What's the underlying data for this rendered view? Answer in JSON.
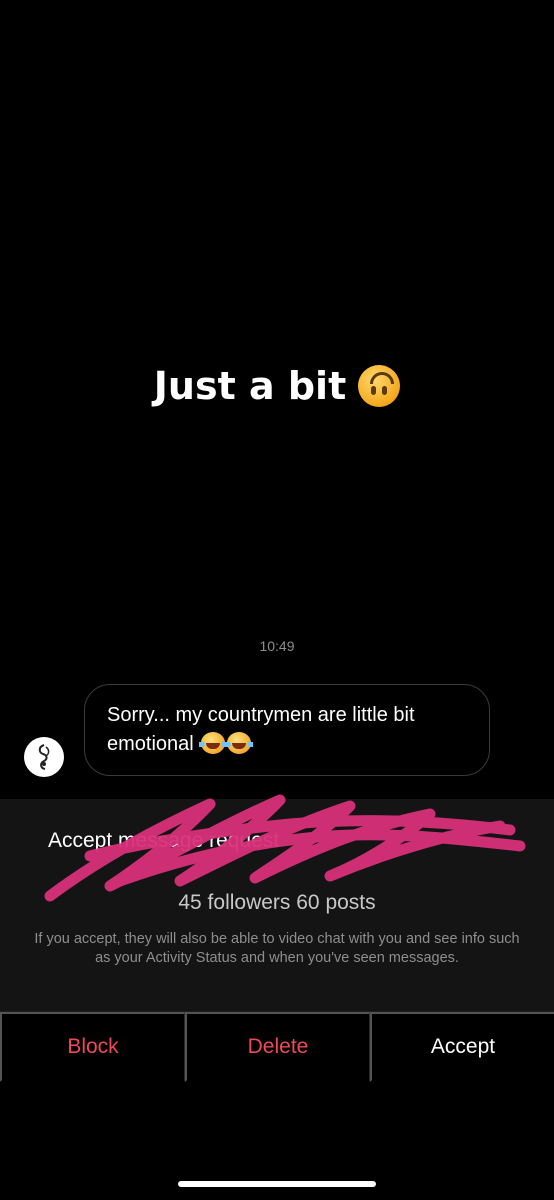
{
  "story": {
    "text": "Just a bit",
    "emoji_icon": "upside-down-face-emoji"
  },
  "thread": {
    "timestamp": "10:49",
    "message": {
      "text": "Sorry... my countrymen are little bit emotional",
      "emoji_icons": [
        "tears-of-joy-emoji",
        "tears-of-joy-emoji"
      ]
    }
  },
  "request": {
    "title_visible": "Accept message request",
    "stats_visible": "45 followers 60 posts",
    "info": "If you accept, they will also be able to video chat with you and see info such as your Activity Status and when you've seen messages."
  },
  "actions": {
    "block": "Block",
    "delete": "Delete",
    "accept": "Accept"
  },
  "colors": {
    "danger": "#ed4956",
    "redaction": "#d8307a"
  }
}
